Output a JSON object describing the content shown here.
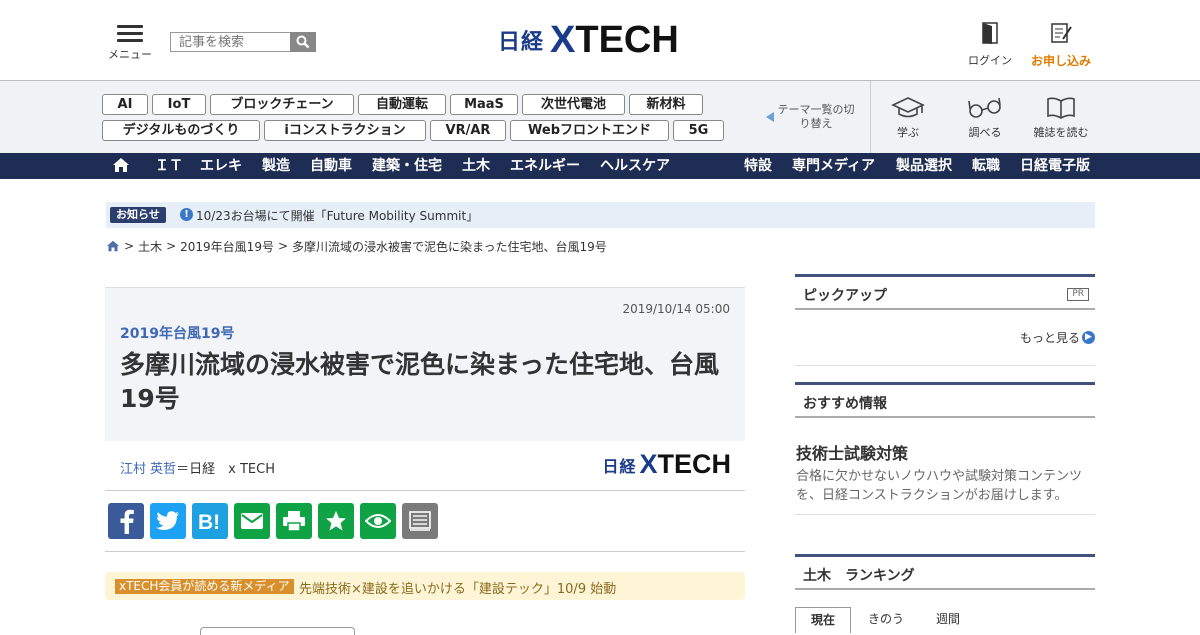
{
  "header": {
    "menu_label": "メニュー",
    "search_placeholder": "記事を検索",
    "logo_nikkei": "日経",
    "logo_x": "X",
    "logo_tech": "TECH",
    "login_label": "ログイン",
    "apply_label": "お申し込み"
  },
  "tags": [
    "AI",
    "IoT",
    "ブロックチェーン",
    "自動運転",
    "MaaS",
    "次世代電池",
    "新材料",
    "デジタルものづくり",
    "iコンストラクション",
    "VR/AR",
    "Webフロントエンド",
    "5G"
  ],
  "theme_switch": "テーマ一覧の切り替え",
  "tools": {
    "learn": "学ぶ",
    "search": "調べる",
    "read": "雑誌を読む"
  },
  "nav": {
    "left": [
      "ＩＴ",
      "エレキ",
      "製造",
      "自動車",
      "建築・住宅",
      "土木",
      "エネルギー",
      "ヘルスケア"
    ],
    "right": [
      "特設",
      "専門メディア",
      "製品選択",
      "転職",
      "日経電子版"
    ]
  },
  "notice": {
    "badge": "お知らせ",
    "text": "10/23お台場にて開催「Future Mobility Summit」"
  },
  "breadcrumb": [
    "土木",
    "2019年台風19号",
    "多摩川流域の浸水被害で泥色に染まった住宅地、台風19号"
  ],
  "article": {
    "date": "2019/10/14 05:00",
    "series": "2019年台風19号",
    "title": "多摩川流域の浸水被害で泥色に染まった住宅地、台風19号",
    "author": "江村 英哲",
    "publisher": "＝日経　x TECH"
  },
  "promo": {
    "badge": "xTECH会員が読める新メディア",
    "text": "先端技術×建設を追いかける「建設テック」10/9 始動"
  },
  "sidebar": {
    "pickup_title": "ピックアップ",
    "pr_label": "PR",
    "more_label": "もっと見る",
    "recommend_title": "おすすめ情報",
    "rec_item_title": "技術士試験対策",
    "rec_item_desc": "合格に欠かせないノウハウや試験対策コンテンツを、日経コンストラクションがお届けします。",
    "ranking_title": "土木　ランキング",
    "ranking_tabs": [
      "現在",
      "きのう",
      "週間"
    ]
  },
  "colors": {
    "nav_bg": "#1e2d53",
    "accent_blue": "#3f68b5",
    "apply_orange": "#e07c00"
  }
}
